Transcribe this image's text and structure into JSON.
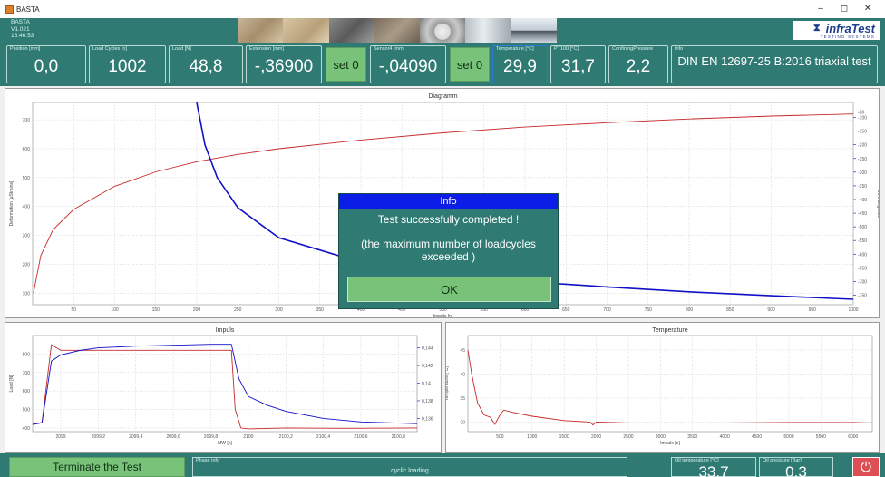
{
  "window": {
    "title": "BASTA",
    "minimize": "–",
    "maximize": "◻",
    "close": "✕"
  },
  "header": {
    "app_name": "BASTA",
    "version": "V1.021",
    "time": "16:46:53",
    "logo": "infraTest",
    "logo_sub": "TESTING SYSTEMS"
  },
  "values": {
    "position": {
      "label": "Position [mm]",
      "value": "0,0"
    },
    "load_cycles": {
      "label": "Load Cycles [n]",
      "value": "1002"
    },
    "load": {
      "label": "Load [N]",
      "value": "48,8"
    },
    "extension": {
      "label": "Extension [mm]",
      "value": "-,36900"
    },
    "set0_a": "set 0",
    "sensor4": {
      "label": "Sensor4 [mm]",
      "value": "-,04090"
    },
    "set0_b": "set 0",
    "temperature": {
      "label": "Temperature [°C]",
      "value": "29,9"
    },
    "pt100": {
      "label": "PT100 [°C]",
      "value": "31,7"
    },
    "confining": {
      "label": "ConfiningPressure",
      "value": "2,2"
    },
    "info": {
      "label": "Info",
      "value": "DIN EN 12697-25 B:2016  triaxial test"
    }
  },
  "diagramm": {
    "title": "Diagramm",
    "ylabel_left": "Deformation [µStrains]",
    "ylabel_right": "Dehnungsrate",
    "xlabel": "Impuls [n]",
    "x_ticks": [
      "50",
      "100",
      "150",
      "200",
      "250",
      "300",
      "350",
      "400",
      "450",
      "500",
      "550",
      "600",
      "650",
      "700",
      "750",
      "800",
      "850",
      "900",
      "950",
      "1000"
    ],
    "y_left_ticks": [
      "700",
      "600",
      "500",
      "400",
      "300",
      "200",
      "100"
    ],
    "y_right_ticks": [
      "-80",
      "-100",
      "-150",
      "-200",
      "-250",
      "-300",
      "-350",
      "-400",
      "-450",
      "-500",
      "-550",
      "-600",
      "-650",
      "-700",
      "-750"
    ]
  },
  "chart_data": [
    {
      "type": "line",
      "title": "Diagramm",
      "xlabel": "Impuls [n]",
      "ylabel": "Deformation [µStrains]",
      "y2label": "Dehnungsrate",
      "xlim": [
        0,
        1000
      ],
      "ylim": [
        60,
        760
      ],
      "y2lim": [
        -785,
        -45
      ],
      "series": [
        {
          "color": "#c62828",
          "axis": "left",
          "x": [
            1,
            10,
            25,
            50,
            100,
            150,
            200,
            250,
            300,
            400,
            500,
            600,
            700,
            800,
            900,
            1000
          ],
          "y": [
            100,
            230,
            320,
            390,
            470,
            520,
            555,
            580,
            600,
            630,
            655,
            675,
            690,
            703,
            713,
            720
          ]
        },
        {
          "color": "#1010c8",
          "axis": "right",
          "x": [
            200,
            210,
            225,
            250,
            300,
            400,
            500,
            600,
            700,
            800,
            900,
            1000
          ],
          "y": [
            -45,
            -200,
            -320,
            -430,
            -540,
            -630,
            -670,
            -700,
            -720,
            -738,
            -752,
            -765
          ]
        }
      ]
    },
    {
      "type": "line",
      "title": "Impuls",
      "xlabel": "MW [n]",
      "ylabel": "Load [N]",
      "y2label": "Deformation [mm]",
      "xlim": [
        2098.85,
        2100.9
      ],
      "ylim": [
        380,
        900
      ],
      "y2lim": [
        0.1345,
        0.1454
      ],
      "x_ticks": [
        "2099",
        "2099,2",
        "2099,4",
        "2099,6",
        "2099,8",
        "2100",
        "2100,2",
        "2100,4",
        "2100,6",
        "2100,8"
      ],
      "y_ticks": [
        "800",
        "700",
        "600",
        "500",
        "400"
      ],
      "y2_ticks": [
        "0,144",
        "0,142",
        "0,14",
        "0,138",
        "0,136"
      ],
      "series": [
        {
          "color": "#c62828",
          "axis": "left",
          "x": [
            2098.85,
            2098.9,
            2098.95,
            2099.0,
            2099.2,
            2099.5,
            2099.8,
            2099.91,
            2099.93,
            2099.96,
            2100.0,
            2100.2,
            2100.5,
            2100.9
          ],
          "y": [
            420,
            430,
            850,
            820,
            820,
            820,
            820,
            820,
            500,
            400,
            395,
            400,
            398,
            400
          ]
        },
        {
          "color": "#1010c8",
          "axis": "right",
          "x": [
            2098.85,
            2098.9,
            2098.95,
            2099.0,
            2099.1,
            2099.2,
            2099.4,
            2099.6,
            2099.8,
            2099.91,
            2099.95,
            2100.0,
            2100.1,
            2100.2,
            2100.4,
            2100.6,
            2100.9
          ],
          "y": [
            0.1353,
            0.1355,
            0.1425,
            0.1432,
            0.1437,
            0.144,
            0.1442,
            0.1443,
            0.1444,
            0.1444,
            0.1405,
            0.1385,
            0.1375,
            0.1368,
            0.136,
            0.1356,
            0.1354
          ]
        }
      ]
    },
    {
      "type": "line",
      "title": "Temperature",
      "xlabel": "Impuls [n]",
      "ylabel": "Temperature [°C]",
      "xlim": [
        0,
        6300
      ],
      "ylim": [
        28,
        48
      ],
      "x_ticks": [
        "500",
        "1000",
        "1500",
        "2000",
        "2500",
        "3000",
        "3500",
        "4000",
        "4500",
        "5000",
        "5500",
        "6000"
      ],
      "y_ticks": [
        "45",
        "40",
        "35",
        "30"
      ],
      "series": [
        {
          "color": "#c62828",
          "x": [
            0,
            60,
            150,
            250,
            350,
            420,
            500,
            560,
            700,
            1000,
            1500,
            1900,
            1950,
            2000,
            2500,
            3000,
            4000,
            5000,
            6000,
            6300
          ],
          "y": [
            45,
            40,
            34,
            31.5,
            31,
            29.5,
            31.5,
            32.5,
            32,
            31.2,
            30.3,
            30,
            29.4,
            30,
            29.8,
            29.8,
            29.8,
            29.9,
            29.9,
            29.8
          ]
        }
      ]
    }
  ],
  "impuls": {
    "title": "Impuls",
    "ylabel": "Load [N]",
    "y2label": "Deformation [mm]",
    "xlabel": "MW [n]",
    "x_ticks": [
      "2099",
      "2099,2",
      "2099,4",
      "2099,6",
      "2099,8",
      "2100",
      "2100,2",
      "2100,4",
      "2100,6",
      "2100,8"
    ],
    "y_ticks": [
      "800",
      "700",
      "600",
      "500",
      "400"
    ],
    "y2_ticks": [
      "0,144",
      "0,142",
      "0,14",
      "0,138",
      "0,136"
    ]
  },
  "temperature": {
    "title": "Temperature",
    "ylabel": "Temperature [°C]",
    "xlabel": "Impuls [n]",
    "x_ticks": [
      "500",
      "1000",
      "1500",
      "2000",
      "2500",
      "3000",
      "3500",
      "4000",
      "4500",
      "5000",
      "5500",
      "6000"
    ],
    "y_ticks": [
      "45",
      "40",
      "35",
      "30"
    ]
  },
  "dialog": {
    "title": "Info",
    "message": "Test successfully completed !",
    "detail": "(the maximum number of loadcycles exceeded )",
    "ok": "OK"
  },
  "bottom": {
    "terminate": "Terminate the Test",
    "phase_label": "Phase info",
    "phase_value": "cyclic loading",
    "oil_temp": {
      "label": "Oil temperature [°C]",
      "value": "33,7"
    },
    "oil_pressure": {
      "label": "Oil pressure [Bar]",
      "value": "0,3"
    },
    "power_icon": "⏻"
  },
  "colors": {
    "teal": "#2f7b73",
    "green_button": "#79c27a",
    "dialog_header": "#0c1de8",
    "curve_red": "#c62828",
    "curve_blue": "#1010c8"
  }
}
